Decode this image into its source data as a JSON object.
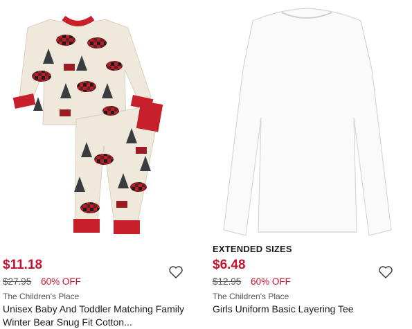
{
  "products": [
    {
      "badge": "",
      "price": "$11.18",
      "was_price": "$27.95",
      "discount": "60% OFF",
      "brand": "The Children's Place",
      "title": "Unisex Baby And Toddler Matching Family Winter Bear Snug Fit Cotton...",
      "image_icon": "bear-pajama-set-image",
      "wishlist_icon": "heart-icon"
    },
    {
      "badge": "EXTENDED SIZES",
      "price": "$6.48",
      "was_price": "$12.95",
      "discount": "60% OFF",
      "brand": "The Children's Place",
      "title": "Girls Uniform Basic Layering Tee",
      "image_icon": "white-tee-image",
      "wishlist_icon": "heart-icon"
    }
  ],
  "colors": {
    "sale_red": "#c41230",
    "text": "#1a1a1a",
    "muted": "#555555"
  }
}
